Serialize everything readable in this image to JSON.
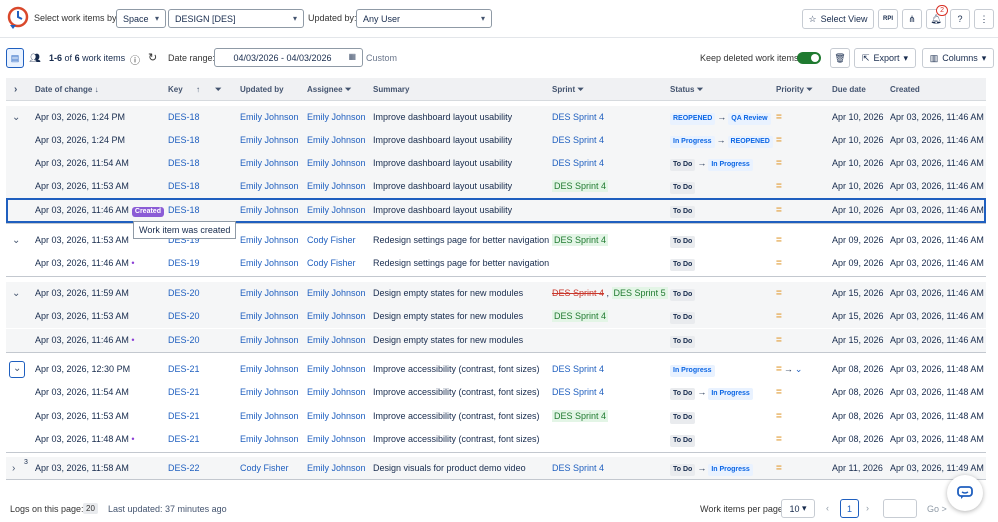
{
  "topbar": {
    "select_label": "Select work items by:",
    "space_select": "Space",
    "design_select": "DESIGN [DES]",
    "updated_label": "Updated by:",
    "user_select": "Any User",
    "select_view": "Select View",
    "rpi_label": "RPI",
    "notif_count": "2"
  },
  "toolbar": {
    "count_prefix": "1-6",
    "count_of": "of",
    "count_total": "6",
    "count_suffix": "work items",
    "date_range_label": "Date range:",
    "date_range_value": "04/03/2026 - 04/03/2026",
    "custom": "Custom",
    "keep_deleted": "Keep deleted work items",
    "export": "Export",
    "columns": "Columns"
  },
  "columns": {
    "date": "Date of change",
    "key": "Key",
    "updated_by": "Updated by",
    "assignee": "Assignee",
    "summary": "Summary",
    "sprint": "Sprint",
    "status": "Status",
    "priority": "Priority",
    "due": "Due date",
    "created": "Created"
  },
  "rows": [
    {
      "date": "Apr 03, 2026, 1:24 PM",
      "key": "DES-18",
      "updated_by": "Emily Johnson",
      "assignee": "Emily Johnson",
      "summary": "Improve dashboard layout usability",
      "sprint": "DES Sprint 4",
      "status_from": "REOPENED",
      "status_to": "QA Review",
      "due": "Apr 10, 2026",
      "created": "Apr 03, 2026, 11:46 AM"
    },
    {
      "date": "Apr 03, 2026, 1:24 PM",
      "key": "DES-18",
      "updated_by": "Emily Johnson",
      "assignee": "Emily Johnson",
      "summary": "Improve dashboard layout usability",
      "sprint": "DES Sprint 4",
      "status_from": "In Progress",
      "status_to": "REOPENED",
      "due": "Apr 10, 2026",
      "created": "Apr 03, 2026, 11:46 AM"
    },
    {
      "date": "Apr 03, 2026, 11:54 AM",
      "key": "DES-18",
      "updated_by": "Emily Johnson",
      "assignee": "Emily Johnson",
      "summary": "Improve dashboard layout usability",
      "sprint": "DES Sprint 4",
      "status_from": "To Do",
      "status_to": "In Progress",
      "due": "Apr 10, 2026",
      "created": "Apr 03, 2026, 11:46 AM"
    },
    {
      "date": "Apr 03, 2026, 11:53 AM",
      "key": "DES-18",
      "updated_by": "Emily Johnson",
      "assignee": "Emily Johnson",
      "summary": "Improve dashboard layout usability",
      "sprint": "DES Sprint 4",
      "status": "To Do",
      "due": "Apr 10, 2026",
      "created": "Apr 03, 2026, 11:46 AM"
    },
    {
      "date": "Apr 03, 2026, 11:46 AM",
      "created_tag": "Created",
      "key": "DES-18",
      "updated_by": "Emily Johnson",
      "assignee": "Emily Johnson",
      "summary": "Improve dashboard layout usability",
      "status": "To Do",
      "due": "Apr 10, 2026",
      "created": "Apr 03, 2026, 11:46 AM"
    },
    {
      "date": "Apr 03, 2026, 11:53 AM",
      "key": "DES-19",
      "updated_by": "Emily Johnson",
      "assignee": "Cody Fisher",
      "summary": "Redesign settings page for better navigation",
      "sprint": "DES Sprint 4",
      "status": "To Do",
      "due": "Apr 09, 2026",
      "created": "Apr 03, 2026, 11:46 AM"
    },
    {
      "date": "Apr 03, 2026, 11:46 AM",
      "key": "DES-19",
      "updated_by": "Emily Johnson",
      "assignee": "Cody Fisher",
      "summary": "Redesign settings page for better navigation",
      "status": "To Do",
      "due": "Apr 09, 2026",
      "created": "Apr 03, 2026, 11:46 AM"
    },
    {
      "date": "Apr 03, 2026, 11:59 AM",
      "key": "DES-20",
      "updated_by": "Emily Johnson",
      "assignee": "Emily Johnson",
      "summary": "Design empty states for new modules",
      "sprint_old": "DES Sprint 4",
      "sprint": "DES Sprint 5",
      "status": "To Do",
      "due": "Apr 15, 2026",
      "created": "Apr 03, 2026, 11:46 AM"
    },
    {
      "date": "Apr 03, 2026, 11:53 AM",
      "key": "DES-20",
      "updated_by": "Emily Johnson",
      "assignee": "Emily Johnson",
      "summary": "Design empty states for new modules",
      "sprint": "DES Sprint 4",
      "status": "To Do",
      "due": "Apr 15, 2026",
      "created": "Apr 03, 2026, 11:46 AM"
    },
    {
      "date": "Apr 03, 2026, 11:46 AM",
      "key": "DES-20",
      "updated_by": "Emily Johnson",
      "assignee": "Emily Johnson",
      "summary": "Design empty states for new modules",
      "status": "To Do",
      "due": "Apr 15, 2026",
      "created": "Apr 03, 2026, 11:46 AM"
    },
    {
      "date": "Apr 03, 2026, 12:30 PM",
      "key": "DES-21",
      "updated_by": "Emily Johnson",
      "assignee": "Emily Johnson",
      "summary": "Improve accessibility (contrast, font sizes)",
      "sprint": "DES Sprint 4",
      "status": "In Progress",
      "due": "Apr 08, 2026",
      "created": "Apr 03, 2026, 11:48 AM"
    },
    {
      "date": "Apr 03, 2026, 11:54 AM",
      "key": "DES-21",
      "updated_by": "Emily Johnson",
      "assignee": "Emily Johnson",
      "summary": "Improve accessibility (contrast, font sizes)",
      "sprint": "DES Sprint 4",
      "status_from": "To Do",
      "status_to": "In Progress",
      "due": "Apr 08, 2026",
      "created": "Apr 03, 2026, 11:48 AM"
    },
    {
      "date": "Apr 03, 2026, 11:53 AM",
      "key": "DES-21",
      "updated_by": "Emily Johnson",
      "assignee": "Emily Johnson",
      "summary": "Improve accessibility (contrast, font sizes)",
      "sprint": "DES Sprint 4",
      "status": "To Do",
      "due": "Apr 08, 2026",
      "created": "Apr 03, 2026, 11:48 AM"
    },
    {
      "date": "Apr 03, 2026, 11:48 AM",
      "key": "DES-21",
      "updated_by": "Emily Johnson",
      "assignee": "Emily Johnson",
      "summary": "Improve accessibility (contrast, font sizes)",
      "status": "To Do",
      "due": "Apr 08, 2026",
      "created": "Apr 03, 2026, 11:48 AM"
    },
    {
      "date": "Apr 03, 2026, 11:58 AM",
      "group_count": "3",
      "key": "DES-22",
      "updated_by": "Cody Fisher",
      "assignee": "Emily Johnson",
      "summary": "Design visuals for product demo video",
      "sprint": "DES Sprint 4",
      "status_from": "To Do",
      "status_to": "In Progress",
      "due": "Apr 11, 2026",
      "created": "Apr 03, 2026, 11:49 AM"
    }
  ],
  "tooltip": "Work item was created",
  "footer": {
    "logs_label": "Logs on this page:",
    "logs_count": "20",
    "last_updated": "Last updated: 37 minutes ago",
    "per_page_label": "Work items per page",
    "per_page": "10",
    "page": "1",
    "go": "Go >"
  },
  "colors": {
    "accent": "#1f5fbf",
    "created_tag": "#8b5cd6",
    "priority": "#e2a03f"
  }
}
